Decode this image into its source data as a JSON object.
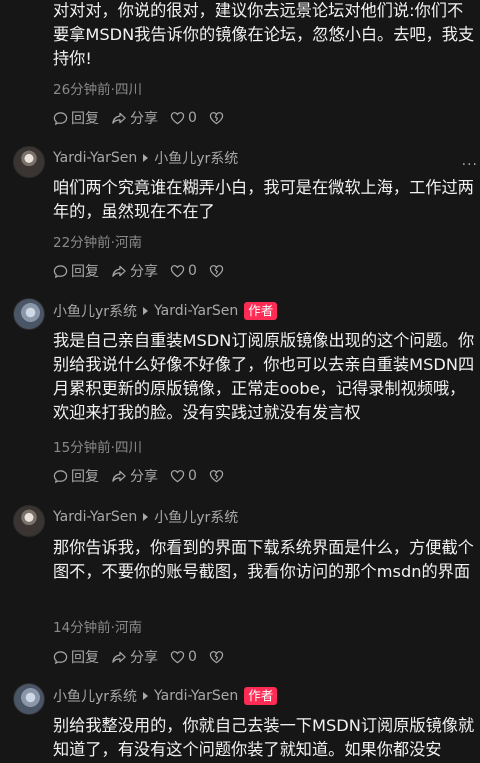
{
  "comments": [
    {
      "text": "对对对，你说的很对，建议你去远景论坛对他们说:你们不要拿MSDN我告诉你的镜像在论坛，忽悠小白。去吧，我支持你!",
      "time_location": "26分钟前·四川",
      "reply": "回复",
      "share": "分享",
      "likes": "0"
    },
    {
      "author": "Yardi-YarSen",
      "reply_to": "小鱼儿yr系统",
      "text": "咱们两个究竟谁在糊弄小白，我可是在微软上海，工作过两年的，虽然现在不在了",
      "time_location": "22分钟前·河南",
      "reply": "回复",
      "share": "分享",
      "likes": "0",
      "more": "···"
    },
    {
      "author": "小鱼儿yr系统",
      "reply_to": "Yardi-YarSen",
      "badge": "作者",
      "text": "我是自己亲自重装MSDN订阅原版镜像出现的这个问题。你别给我说什么好像不好像了，你也可以去亲自重装MSDN四月累积更新的原版镜像，正常走oobe，记得录制视频哦，欢迎来打我的脸。没有实践过就没有发言权",
      "time_location": "15分钟前·四川",
      "reply": "回复",
      "share": "分享",
      "likes": "0"
    },
    {
      "author": "Yardi-YarSen",
      "reply_to": "小鱼儿yr系统",
      "text": "那你告诉我，你看到的界面下载系统界面是什么，方便截个图不，不要你的账号截图，我看你访问的那个msdn的界面",
      "time_location": "14分钟前·河南",
      "reply": "回复",
      "share": "分享",
      "likes": "0"
    },
    {
      "author": "小鱼儿yr系统",
      "reply_to": "Yardi-YarSen",
      "badge": "作者",
      "text": "别给我整没用的，你就自己去装一下MSDN订阅原版镜像就知道了，有没有这个问题你装了就知道。如果你都没安"
    }
  ]
}
